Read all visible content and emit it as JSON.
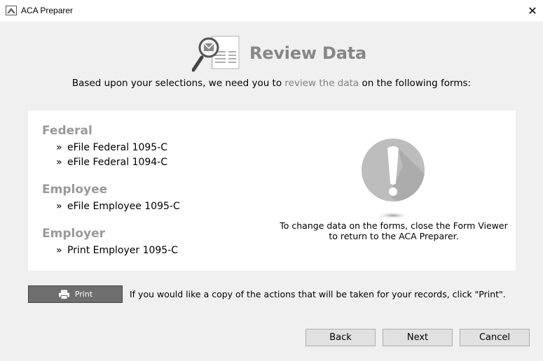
{
  "window": {
    "title": "ACA Preparer",
    "app_icon": "aca-logo-icon",
    "close_glyph": "✕"
  },
  "header": {
    "title": "Review Data",
    "icon": "magnifier-document-icon"
  },
  "intro": {
    "before": "Based upon your selections, we need you to ",
    "highlight": "review the data",
    "after": " on the following forms:"
  },
  "forms": {
    "groups": [
      {
        "title": "Federal",
        "items": [
          "eFile Federal 1095-C",
          "eFile Federal 1094-C"
        ]
      },
      {
        "title": "Employee",
        "items": [
          "eFile Employee 1095-C"
        ]
      },
      {
        "title": "Employer",
        "items": [
          "Print Employer 1095-C"
        ]
      }
    ],
    "bullet": "»"
  },
  "notice": {
    "icon": "exclamation-icon",
    "line1": "To change data on the forms, close the Form Viewer",
    "line2": "to return to the ACA Preparer."
  },
  "print": {
    "label": "Print",
    "hint": "If you would like a copy of the actions that will be taken for your records, click \"Print\"."
  },
  "buttons": {
    "back": "Back",
    "next": "Next",
    "cancel": "Cancel"
  },
  "colors": {
    "panel_bg": "#ffffff",
    "window_bg": "#f0f0f0",
    "heading_gray": "#868686",
    "group_gray": "#999999",
    "print_btn": "#6e6e6e"
  }
}
